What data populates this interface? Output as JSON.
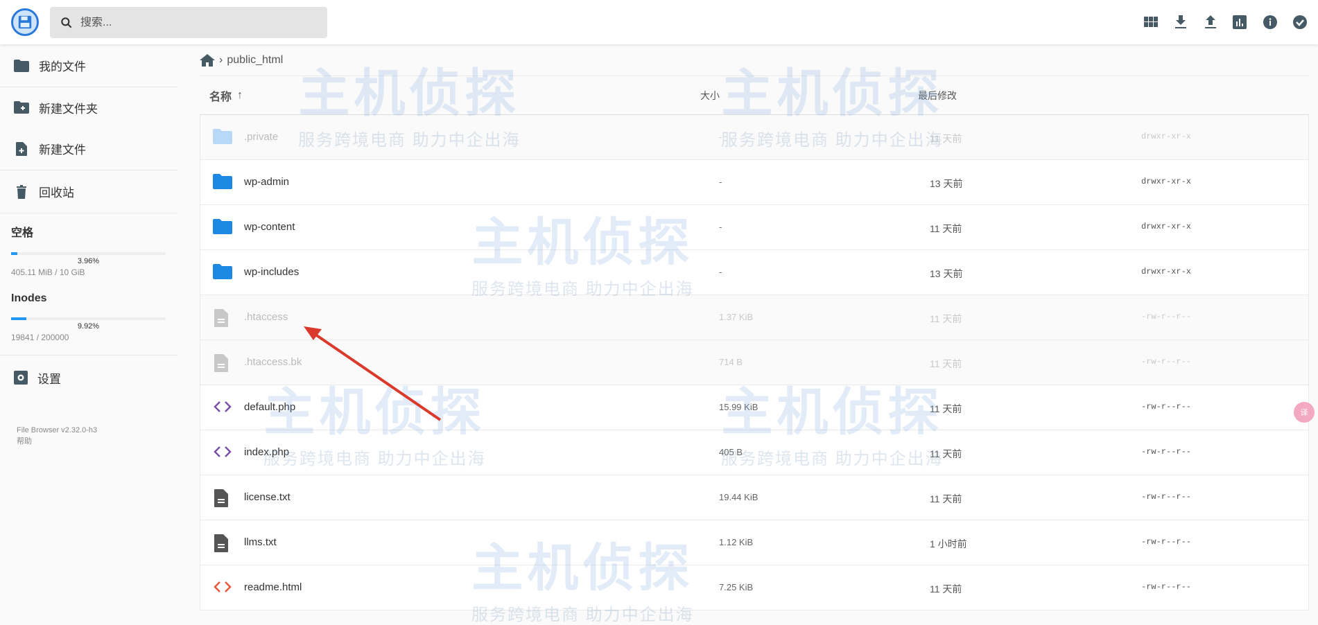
{
  "header": {
    "search_placeholder": "搜索...",
    "toolbar": [
      "grid-view",
      "download",
      "upload",
      "usage",
      "info",
      "select"
    ]
  },
  "sidebar": {
    "items": [
      {
        "label": "我的文件"
      },
      {
        "label": "新建文件夹"
      },
      {
        "label": "新建文件"
      },
      {
        "label": "回收站"
      }
    ],
    "space": {
      "title": "空格",
      "percent_label": "3.96%",
      "percent": 3.96,
      "usage": "405.11 MiB / 10 GiB"
    },
    "inodes": {
      "title": "Inodes",
      "percent_label": "9.92%",
      "percent": 9.92,
      "usage": "19841 / 200000"
    },
    "settings": "设置",
    "version": "File Browser v2.32.0-h3",
    "help": "帮助"
  },
  "breadcrumb": {
    "current": "public_html"
  },
  "columns": {
    "name": "名称",
    "size": "大小",
    "modified": "最后修改"
  },
  "files": [
    {
      "name": ".private",
      "type": "folder",
      "size": "-",
      "modified": "11 天前",
      "perms": "drwxr-xr-x",
      "hidden": true
    },
    {
      "name": "wp-admin",
      "type": "folder",
      "size": "-",
      "modified": "13 天前",
      "perms": "drwxr-xr-x",
      "hidden": false
    },
    {
      "name": "wp-content",
      "type": "folder",
      "size": "-",
      "modified": "11 天前",
      "perms": "drwxr-xr-x",
      "hidden": false
    },
    {
      "name": "wp-includes",
      "type": "folder",
      "size": "-",
      "modified": "13 天前",
      "perms": "drwxr-xr-x",
      "hidden": false
    },
    {
      "name": ".htaccess",
      "type": "file",
      "size": "1.37 KiB",
      "modified": "11 天前",
      "perms": "-rw-r--r--",
      "hidden": true
    },
    {
      "name": ".htaccess.bk",
      "type": "file",
      "size": "714 B",
      "modified": "11 天前",
      "perms": "-rw-r--r--",
      "hidden": true
    },
    {
      "name": "default.php",
      "type": "code",
      "size": "15.99 KiB",
      "modified": "11 天前",
      "perms": "-rw-r--r--",
      "hidden": false
    },
    {
      "name": "index.php",
      "type": "code",
      "size": "405 B",
      "modified": "11 天前",
      "perms": "-rw-r--r--",
      "hidden": false
    },
    {
      "name": "license.txt",
      "type": "text",
      "size": "19.44 KiB",
      "modified": "11 天前",
      "perms": "-rw-r--r--",
      "hidden": false
    },
    {
      "name": "llms.txt",
      "type": "text",
      "size": "1.12 KiB",
      "modified": "1 小时前",
      "perms": "-rw-r--r--",
      "hidden": false
    },
    {
      "name": "readme.html",
      "type": "html",
      "size": "7.25 KiB",
      "modified": "11 天前",
      "perms": "-rw-r--r--",
      "hidden": false
    }
  ],
  "watermark": {
    "title": "主机侦探",
    "slogan": "服务跨境电商 助力中企出海"
  },
  "translate_badge": "译",
  "colors": {
    "accent": "#2196f3",
    "icon": "#455a64",
    "folder": "#1e88e5",
    "code_php": "#7b4fa8",
    "code_html": "#e4593d",
    "arrow": "#d93a2b"
  }
}
